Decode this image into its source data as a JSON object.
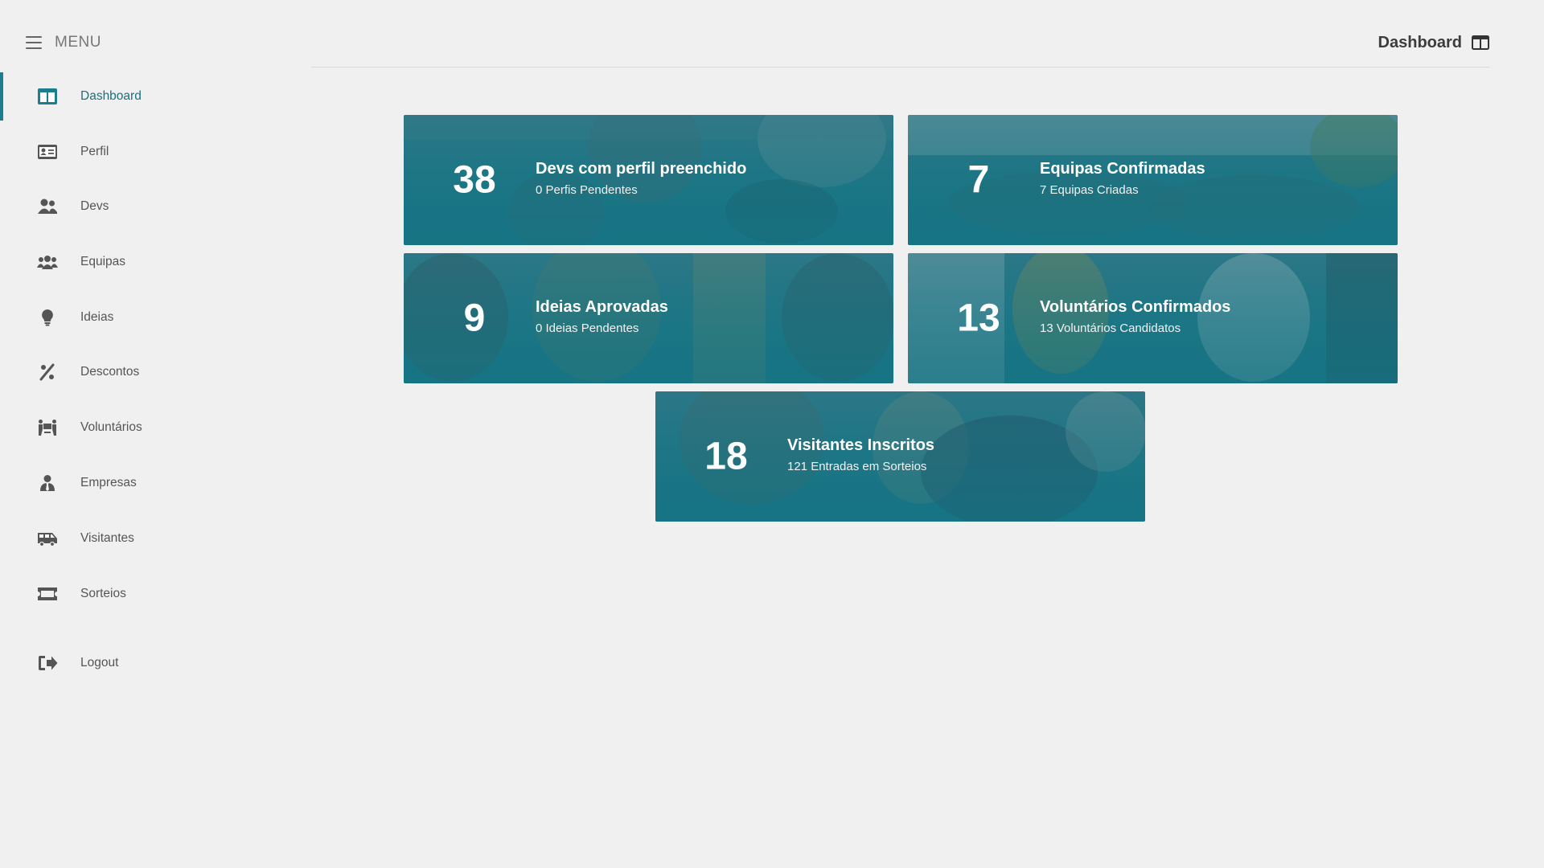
{
  "sidebar": {
    "menu_label": "MENU",
    "items": [
      {
        "label": "Dashboard"
      },
      {
        "label": "Perfil"
      },
      {
        "label": "Devs"
      },
      {
        "label": "Equipas"
      },
      {
        "label": "Ideias"
      },
      {
        "label": "Descontos"
      },
      {
        "label": "Voluntários"
      },
      {
        "label": "Empresas"
      },
      {
        "label": "Visitantes"
      },
      {
        "label": "Sorteios"
      }
    ],
    "logout_label": "Logout"
  },
  "header": {
    "title": "Dashboard"
  },
  "cards": [
    {
      "number": "38",
      "title": "Devs com perfil preenchido",
      "subtitle": "0 Perfis Pendentes"
    },
    {
      "number": "7",
      "title": "Equipas Confirmadas",
      "subtitle": "7 Equipas Criadas"
    },
    {
      "number": "9",
      "title": "Ideias Aprovadas",
      "subtitle": "0 Ideias Pendentes"
    },
    {
      "number": "13",
      "title": "Voluntários Confirmados",
      "subtitle": "13 Voluntários Candidatos"
    },
    {
      "number": "18",
      "title": "Visitantes Inscritos",
      "subtitle": "121 Entradas em Sorteios"
    }
  ],
  "colors": {
    "accent": "#1c7e8c",
    "card_background": "#1f7787",
    "page_background": "#f0f0f0"
  }
}
